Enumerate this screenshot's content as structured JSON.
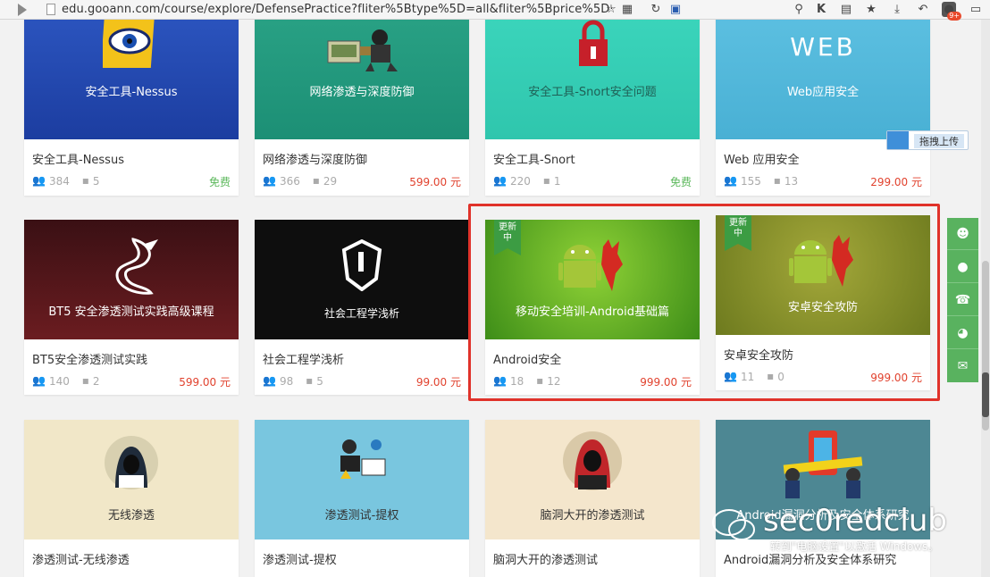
{
  "browser": {
    "url": "edu.gooann.com/course/explore/DefensePractice?fliter%5Btype%5D=all&fliter%5Bprice%5D·",
    "badge_k": "K",
    "notif_count": "9+"
  },
  "upload_button": {
    "label": "拖拽上传"
  },
  "sidebar": {
    "items": [
      "qq-icon",
      "chat-icon",
      "phone-icon",
      "wechat-icon",
      "mail-icon"
    ]
  },
  "colors": {
    "price": "#e1422e",
    "free": "#5cb85c",
    "highlight": "#e0322a",
    "sidebar": "#59b25f"
  },
  "courses": [
    {
      "thumb_title": "安全工具-Nessus",
      "name": "安全工具-Nessus",
      "students": "384",
      "comments": "5",
      "price": "免费",
      "free": true
    },
    {
      "thumb_title": "网络渗透与深度防御",
      "name": "网络渗透与深度防御",
      "students": "366",
      "comments": "29",
      "price": "599.00 元",
      "free": false
    },
    {
      "thumb_title": "安全工具-Snort安全问题",
      "name": "安全工具-Snort",
      "students": "220",
      "comments": "1",
      "price": "免费",
      "free": true
    },
    {
      "thumb_title": "Web应用安全",
      "thumb_logo": "WEB",
      "name": "Web 应用安全",
      "students": "155",
      "comments": "13",
      "price": "299.00 元",
      "free": false
    },
    {
      "thumb_title": "BT5 安全渗透测试实践高级课程",
      "name": "BT5安全渗透测试实践",
      "students": "140",
      "comments": "2",
      "price": "599.00 元",
      "free": false
    },
    {
      "thumb_title": "社会工程学浅析",
      "name": "社会工程学浅析",
      "students": "98",
      "comments": "5",
      "price": "99.00 元",
      "free": false
    },
    {
      "thumb_title": "移动安全培训-Android基础篇",
      "name": "Android安全",
      "students": "18",
      "comments": "12",
      "price": "999.00 元",
      "free": false,
      "ribbon": "更新中"
    },
    {
      "thumb_title": "安卓安全攻防",
      "name": "安卓安全攻防",
      "students": "11",
      "comments": "0",
      "price": "999.00 元",
      "free": false,
      "ribbon": "更新中"
    },
    {
      "thumb_title": "无线渗透",
      "name": "渗透测试-无线渗透"
    },
    {
      "thumb_title": "渗透测试-提权",
      "name": "渗透测试-提权"
    },
    {
      "thumb_title": "脑洞大开的渗透测试",
      "name": "脑洞大开的渗透测试"
    },
    {
      "thumb_title": "Android漏洞分析及安全体系研究",
      "name": "Android漏洞分析及安全体系研究"
    }
  ],
  "ribbon_text": {
    "line1": "更新",
    "line2": "中"
  },
  "watermark": {
    "brand": "sec0redclub",
    "sub": "转到\"电脑设置\"以激活 Windows。"
  }
}
